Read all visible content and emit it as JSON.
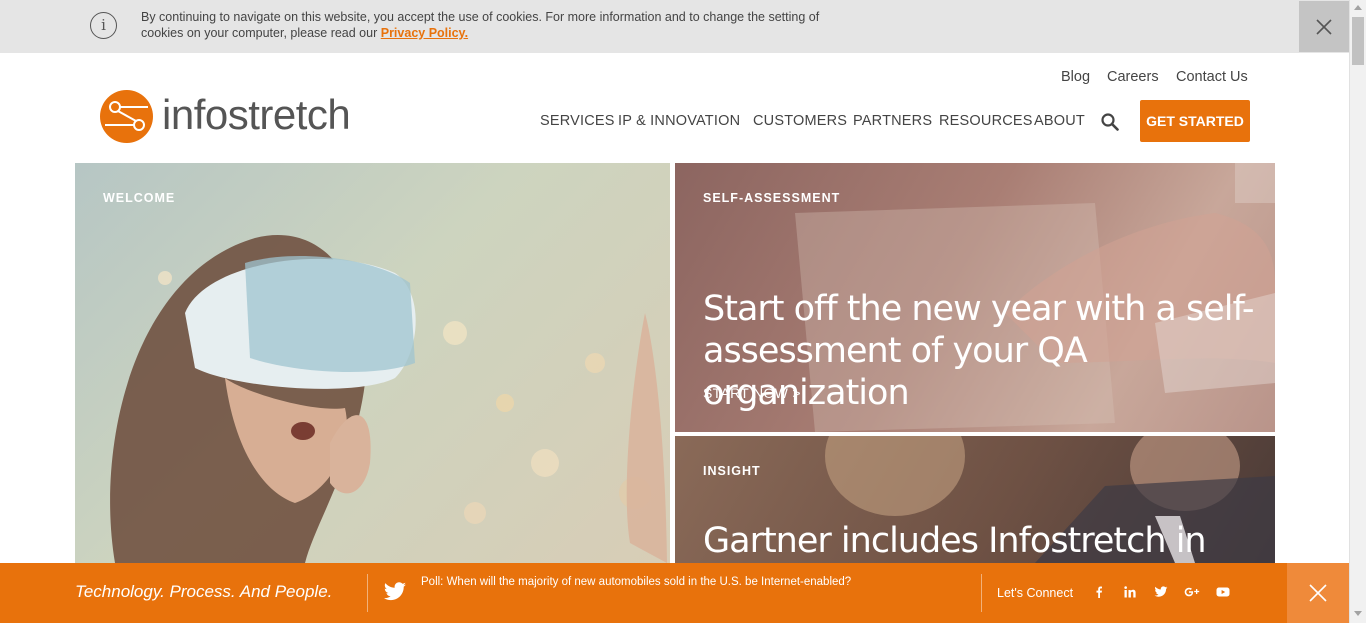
{
  "cookie_bar": {
    "message": "By continuing to navigate on this website, you accept the use of cookies. For more information and to change the setting of cookies on your computer, please read our",
    "link_text": "Privacy Policy.",
    "info_icon": "info-icon",
    "close_icon": "close-icon"
  },
  "header": {
    "logo_text": "infostretch",
    "utility_links": [
      "Blog",
      "Careers",
      "Contact Us"
    ],
    "nav_items": [
      "SERVICES",
      "IP & INNOVATION",
      "CUSTOMERS",
      "PARTNERS",
      "RESOURCES",
      "ABOUT"
    ],
    "search_icon": "search-icon",
    "cta_label": "GET STARTED"
  },
  "tiles": [
    {
      "kicker": "WELCOME",
      "headline": "",
      "link": ""
    },
    {
      "kicker": "SELF-ASSESSMENT",
      "headline": "Start off the new year with a self-assessment of your QA organization",
      "link": "START NOW >"
    },
    {
      "kicker": "INSIGHT",
      "headline": "Gartner includes Infostretch in",
      "link": ""
    }
  ],
  "footer": {
    "tagline": "Technology. Process. And People.",
    "poll_text": "Poll: When will the majority of new automobiles sold in the U.S. be Internet-enabled?",
    "connect_label": "Let's Connect",
    "social_icons": [
      "facebook-icon",
      "linkedin-icon",
      "twitter-icon",
      "google-plus-icon",
      "youtube-icon"
    ],
    "close_icon": "close-icon"
  },
  "colors": {
    "accent": "#e8720c",
    "cookie_bg": "#e5e5e5"
  }
}
